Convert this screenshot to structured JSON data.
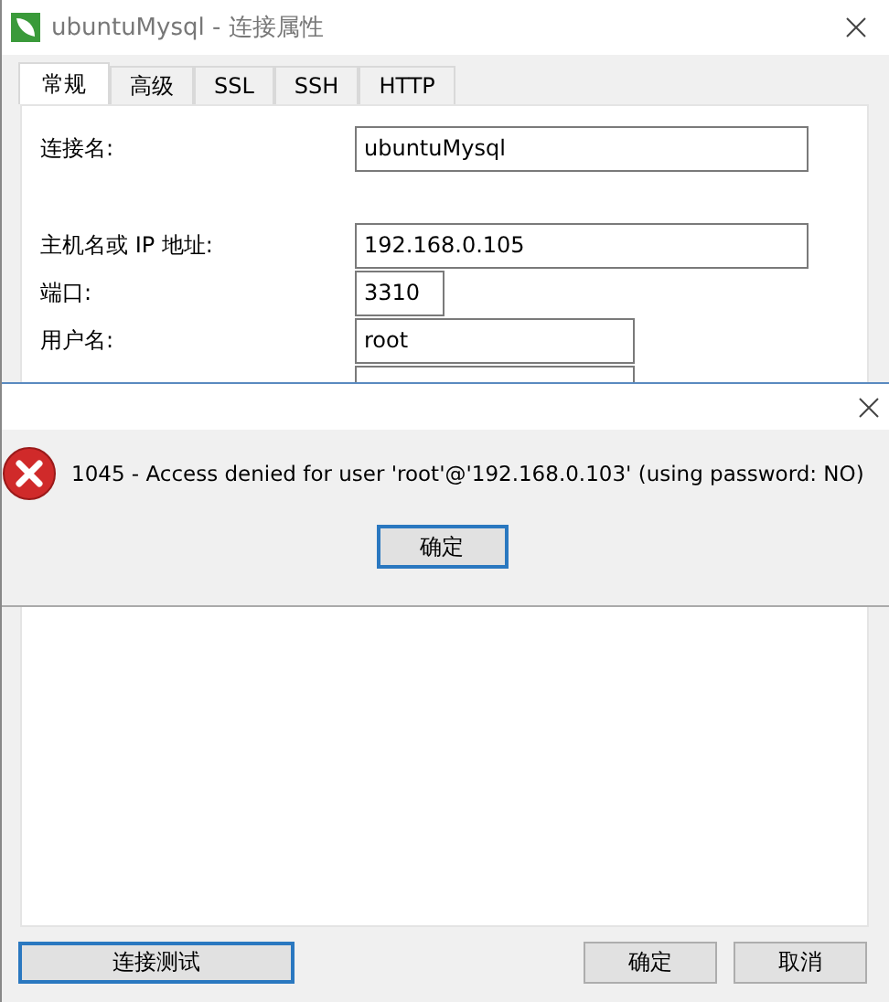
{
  "window": {
    "title": "ubuntuMysql - 连接属性"
  },
  "tabs": [
    {
      "label": "常规",
      "selected": true
    },
    {
      "label": "高级",
      "selected": false
    },
    {
      "label": "SSL",
      "selected": false
    },
    {
      "label": "SSH",
      "selected": false
    },
    {
      "label": "HTTP",
      "selected": false
    }
  ],
  "fields": [
    {
      "kind": "text",
      "label": "连接名:",
      "value": "ubuntuMysql"
    },
    {
      "kind": "text",
      "label": "主机名或 IP 地址:",
      "value": "192.168.0.105"
    },
    {
      "kind": "text",
      "label": "端口:",
      "value": "3310"
    },
    {
      "kind": "text",
      "label": "用户名:",
      "value": "root"
    },
    {
      "kind": "password"
    }
  ],
  "error_dialog": {
    "message": "1045 - Access denied for user 'root'@'192.168.0.103' (using password: NO)",
    "button": "确定"
  },
  "buttons": [
    {
      "label": "连接测试",
      "default": true
    },
    {
      "label": "确定",
      "default": false
    },
    {
      "label": "取消",
      "default": false
    }
  ]
}
